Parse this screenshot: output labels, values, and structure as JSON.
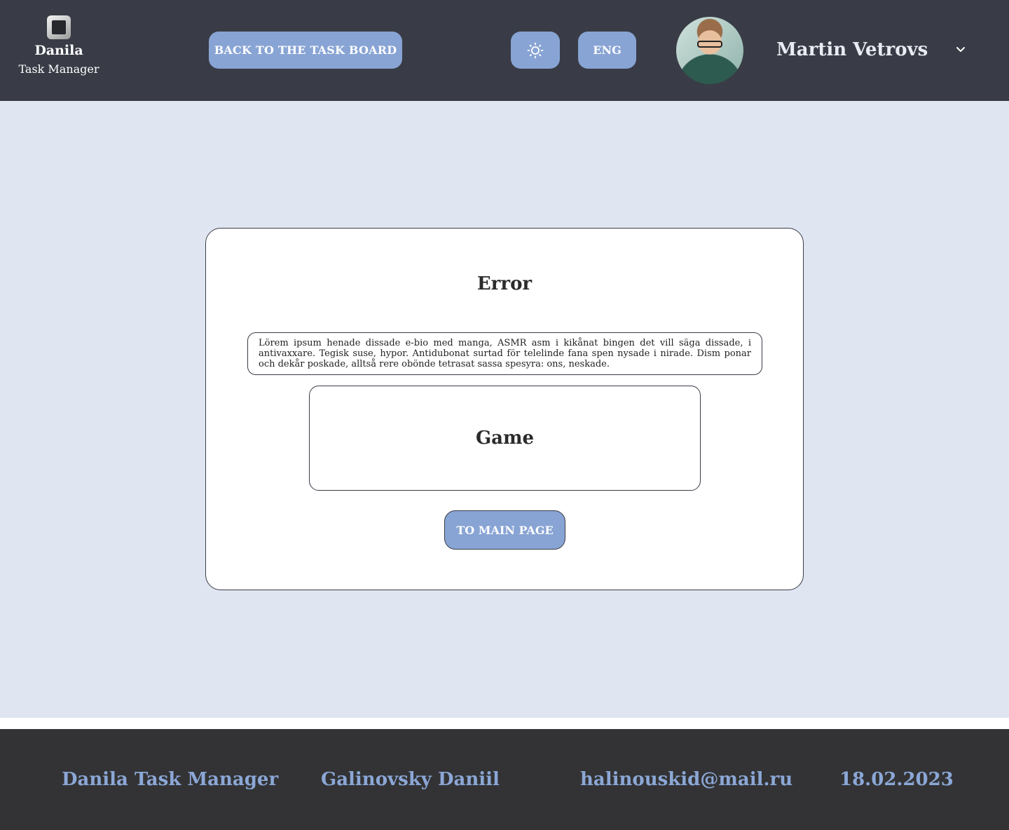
{
  "header": {
    "logo": {
      "name": "Danila",
      "subtitle": "Task Manager",
      "icon": "app-square-icon"
    },
    "back_button": "BACK TO THE TASK BOARD",
    "theme_button_icon": "sun-icon",
    "lang_button": "ENG",
    "user": {
      "name": "Martin Vetrovs",
      "avatar_icon": "user-avatar",
      "menu_icon": "chevron-down-icon"
    }
  },
  "error_card": {
    "title": "Error",
    "message": "Lörem ipsum  henade dissade e-bio med manga, ASMR asm i kikånat bingen det vill säga dissade, i antivaxxare. Tegisk suse, hypor. Antidubonat surtad för telelinde fana spen nysade i nirade. Dism ponar och dekår poskade, alltså rere obönde tetrasat sassa spesyra: ons, neskade.",
    "game_label": "Game",
    "main_button": "TO MAIN PAGE"
  },
  "footer": {
    "app_name": "Danila Task Manager",
    "author": "Galinovsky Daniil",
    "email": "halinouskid@mail.ru",
    "date": "18.02.2023"
  },
  "colors": {
    "header_bg": "#393c46",
    "accent": "#88a4d4",
    "main_bg": "#dfe6f1",
    "footer_bg": "#333335",
    "footer_text": "#8ba7d6"
  }
}
